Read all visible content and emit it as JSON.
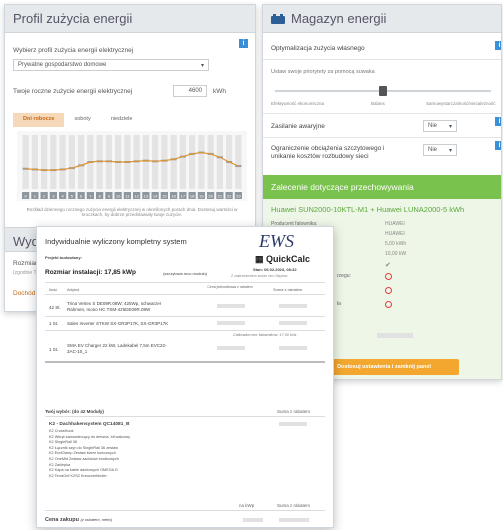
{
  "left": {
    "title": "Profil zużycia energii",
    "profile_label": "Wybierz profil zużycia energii elektrycznej",
    "profile_value": "Prywatne gospodarstwo domowe",
    "annual_label": "Twoje roczne zużycie energii elektrycznej",
    "annual_value": "4600",
    "annual_unit": "kWh",
    "tabs": [
      "Dni robocze",
      "soboty",
      "niedziele"
    ],
    "hours": [
      "0",
      "1",
      "2",
      "3",
      "4",
      "5",
      "6",
      "7",
      "8",
      "9",
      "10",
      "11",
      "12",
      "13",
      "14",
      "15",
      "16",
      "17",
      "18",
      "19",
      "20",
      "21",
      "22",
      "23"
    ],
    "caption": "Rozkład dziennego rocznego zużycia energii elektrycznej w określonych porach dnia. Dostosuj wartości w kroczkach, by dobrze przedstawiały twoje zużycie.",
    "section2_title": "Wydaj",
    "section2_text_1": "Rozmiar i",
    "section2_text_2": "(zgodnie T",
    "section2_link": "Dochód z"
  },
  "right": {
    "title": "Magazyn energii",
    "optim_label": "Optymalizacja zużycia własnego",
    "priority_label": "Ustaw swoje priorytety za pomocą suwaka",
    "slider_left": "Efektywność ekonomiczna",
    "slider_mid": "Balans",
    "slider_right": "Samowystarczalność/niezależność",
    "emergency_label": "Zasilanie awaryjne",
    "emergency_value": "Nie",
    "peak_label_1": "Ograniczenie obciążenia szczytowego i",
    "peak_label_2": "unikanie kosztów rozbudowy sieci",
    "peak_value": "Nie",
    "recommend_title": "Zalecenie dotyczące przechowywania",
    "product": "Huawei SUN2000-10KTL-M1 + Huawei LUNA2000-5 kWh",
    "kv": [
      {
        "k": "Producent falownika:",
        "v": "HUAWEI"
      },
      {
        "k": "",
        "v": "HUAWEI"
      },
      {
        "k": "",
        "v": "5,00 kWh"
      },
      {
        "k": "",
        "v": "10,00 kW"
      }
    ],
    "status_1": "✔",
    "status_2_label": "rzegu:",
    "status_3_label": "ła",
    "cta": "Dostosuj ustawienia i zamknij panel"
  },
  "doc": {
    "title": "Indywidualnie wyliczony kompletny system",
    "brand": "EWS",
    "brand_sub": "QuickCalc",
    "project_label": "Projekt budowlany:",
    "size_title": "Rozmiar instalacji: 17,85 kWp",
    "size_note": "(szczytowa moc modułu)",
    "date": "Stan: 06.02.2023, 08:32",
    "date_note": "Z zastrzeżeniem zmian cen i błędów",
    "col_qty": "Ilość",
    "col_article": "Artykuł",
    "col_unit": "Cena jednostkowa z rabatem",
    "col_sum": "Suma z rabatem",
    "items": [
      {
        "qty": "42 St.",
        "name_1": "Trina Vertex S DE09R.08W; 425Wp, schwarzer",
        "name_2": "Rahmen, mono HC TSM-425DE09R.08W"
      },
      {
        "qty": "1 St.",
        "name_1": "Sales Inverter STKW SX-GR3P17K, SX-GR3P17K",
        "name_2": ""
      },
      {
        "qty": "1 St.",
        "name_1": "SMA EV Charger 22 kW, Ladekabel 7,5m EVC22-",
        "name_2": "3AC-10_1"
      }
    ],
    "total_power": "Całkowita moc falowników: 17,00 kVa",
    "choice_label": "Twój wybór: (do 42 Moduły)",
    "choice_sum": "Suma z rabatem",
    "system_name": "K2 - Dachhakensystem QC14081_B",
    "components": [
      "K2 CrossHook",
      "K2 Wkręt samowiercący do drewna, bit walcowy",
      "K2 SingleRail 36",
      "K2 Łącznik szyn do SingleRail 36 zestaw",
      "K2 EndClamp Zestaw klamr końcowych",
      "K2 OneMid Zestaw zacisków środkowych",
      "K2 Zaślepka",
      "K2 Kapa na kable dachowych OMEGA D",
      "K2 TerraGrif K2SZ Kreuzverbinder"
    ],
    "col_wp": "na kWp",
    "price_label": "Cena zakupu",
    "price_note": "(z rabatem, netto)"
  },
  "colors": {
    "accent_orange": "#f3a72e",
    "green": "#79c24d",
    "info_blue": "#3b8fd6",
    "bar_orange": "#e0952e"
  },
  "chart_data": {
    "type": "bar",
    "categories": [
      "0",
      "1",
      "2",
      "3",
      "4",
      "5",
      "6",
      "7",
      "8",
      "9",
      "10",
      "11",
      "12",
      "13",
      "14",
      "15",
      "16",
      "17",
      "18",
      "19",
      "20",
      "21",
      "22",
      "23"
    ],
    "values": [
      3.0,
      2.9,
      2.8,
      2.8,
      2.9,
      3.1,
      3.5,
      4.0,
      4.1,
      4.1,
      4.0,
      4.0,
      4.1,
      4.2,
      4.1,
      4.2,
      4.4,
      4.8,
      5.2,
      5.4,
      5.2,
      4.7,
      4.0,
      3.4
    ],
    "title": "",
    "xlabel": "",
    "ylabel": ""
  }
}
